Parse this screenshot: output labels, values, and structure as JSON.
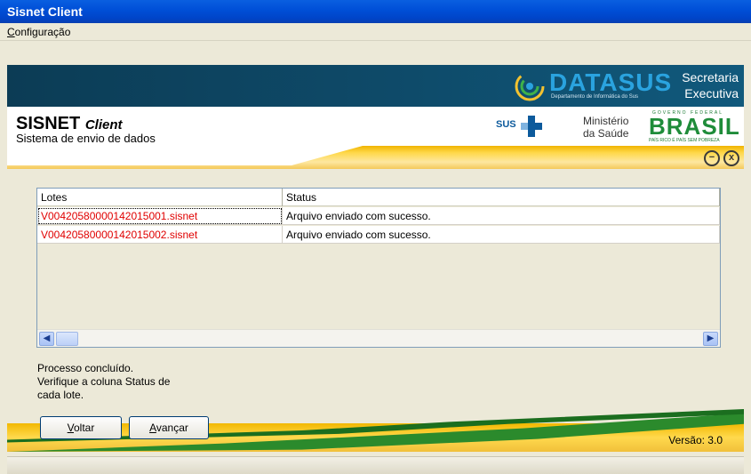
{
  "window": {
    "title": "Sisnet Client"
  },
  "menu": {
    "items": [
      {
        "label": "Configuração",
        "underline": "C",
        "rest": "onfiguração"
      }
    ]
  },
  "banner": {
    "datasus": "DATASUS",
    "datasus_sub": "Departamento de Informática do Sus",
    "secretaria": "Secretaria",
    "executiva": "Executiva"
  },
  "header": {
    "app_name": "SISNET",
    "app_client": "Client",
    "app_subtitle": "Sistema de envio de dados",
    "sus": "SUS",
    "ministerio": "Ministério",
    "saude": "da Saúde",
    "brasil_top": "GOVERNO FEDERAL",
    "brasil": "BRASIL",
    "brasil_bottom": "PAÍS RICO É PAÍS SEM POBREZA"
  },
  "window_controls": {
    "minimize": "−",
    "close": "x"
  },
  "table": {
    "columns": [
      "Lotes",
      "Status"
    ],
    "rows": [
      {
        "lote": "V00420580000142015001.sisnet",
        "status": "Arquivo enviado com sucesso."
      },
      {
        "lote": "V00420580000142015002.sisnet",
        "status": "Arquivo enviado com sucesso."
      }
    ]
  },
  "message": {
    "line1": "Processo concluído.",
    "line2": "Verifique a coluna Status de",
    "line3": "cada lote."
  },
  "buttons": {
    "back": {
      "underline": "V",
      "rest": "oltar"
    },
    "next": {
      "underline": "A",
      "rest": "vançar"
    }
  },
  "footer": {
    "version": "Versão: 3.0"
  },
  "colors": {
    "titlebar": "#0050d8",
    "lote_text": "#e00000",
    "brand_green": "#1f8c3a",
    "brand_yellow": "#f2b800"
  }
}
